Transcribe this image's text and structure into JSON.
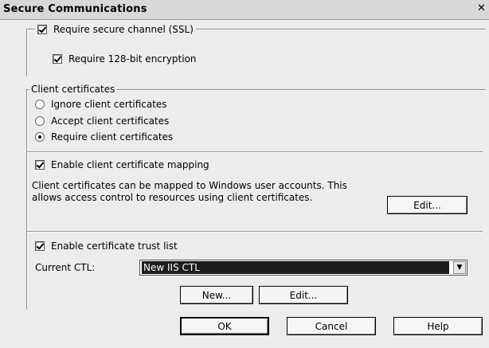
{
  "window": {
    "title": "Secure Communications",
    "close_glyph": "✕"
  },
  "ssl": {
    "require_ssl_label": "Require secure channel (SSL)",
    "require_ssl_checked": true,
    "require_128_label": "Require 128-bit encryption",
    "require_128_checked": true
  },
  "client_certificates": {
    "legend": "Client certificates",
    "options": [
      {
        "label": "Ignore client certificates",
        "selected": false
      },
      {
        "label": "Accept client certificates",
        "selected": false
      },
      {
        "label": "Require client certificates",
        "selected": true
      }
    ]
  },
  "mapping": {
    "enable_label": "Enable client certificate mapping",
    "enable_checked": true,
    "description": "Client certificates can be mapped to Windows user accounts.  This allows access control to resources using client certificates.",
    "edit_label": "Edit..."
  },
  "ctl": {
    "enable_label": "Enable certificate trust list",
    "enable_checked": true,
    "current_label": "Current CTL:",
    "current_value": "New IIS CTL",
    "new_label": "New...",
    "edit_label": "Edit..."
  },
  "footer": {
    "ok_label": "OK",
    "cancel_label": "Cancel",
    "help_label": "Help"
  },
  "icons": {
    "close": "close-icon",
    "checkbox": "checkbox-icon",
    "radio": "radio-icon",
    "dropdown": "chevron-down-icon"
  }
}
